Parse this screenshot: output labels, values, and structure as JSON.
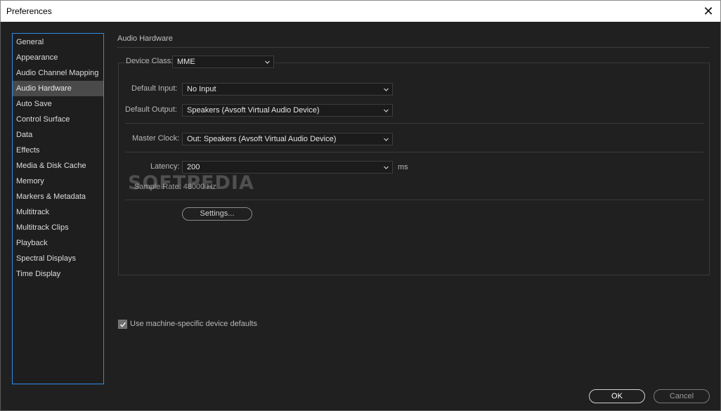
{
  "window": {
    "title": "Preferences",
    "close_glyph": "✕"
  },
  "sidebar": {
    "items": [
      {
        "label": "General",
        "selected": false
      },
      {
        "label": "Appearance",
        "selected": false
      },
      {
        "label": "Audio Channel Mapping",
        "selected": false
      },
      {
        "label": "Audio Hardware",
        "selected": true
      },
      {
        "label": "Auto Save",
        "selected": false
      },
      {
        "label": "Control Surface",
        "selected": false
      },
      {
        "label": "Data",
        "selected": false
      },
      {
        "label": "Effects",
        "selected": false
      },
      {
        "label": "Media & Disk Cache",
        "selected": false
      },
      {
        "label": "Memory",
        "selected": false
      },
      {
        "label": "Markers & Metadata",
        "selected": false
      },
      {
        "label": "Multitrack",
        "selected": false
      },
      {
        "label": "Multitrack Clips",
        "selected": false
      },
      {
        "label": "Playback",
        "selected": false
      },
      {
        "label": "Spectral Displays",
        "selected": false
      },
      {
        "label": "Time Display",
        "selected": false
      }
    ]
  },
  "main": {
    "section_title": "Audio Hardware",
    "device_class": {
      "label": "Device Class:",
      "value": "MME"
    },
    "default_input": {
      "label": "Default Input:",
      "value": "No Input"
    },
    "default_output": {
      "label": "Default Output:",
      "value": "Speakers (Avsoft Virtual Audio Device)"
    },
    "master_clock": {
      "label": "Master Clock:",
      "value": "Out: Speakers (Avsoft Virtual Audio Device)"
    },
    "latency": {
      "label": "Latency:",
      "value": "200",
      "unit": "ms"
    },
    "sample_rate": "Sample Rate: 48000 Hz",
    "settings_button": "Settings...",
    "machine_defaults": {
      "label": "Use machine-specific device defaults",
      "checked": true
    }
  },
  "watermark": "SOFTPEDIA",
  "buttons": {
    "ok": "OK",
    "cancel": "Cancel"
  },
  "colors": {
    "accent_border": "#2d8ceb",
    "background": "#202020",
    "selected_item": "#4a4a4a"
  }
}
